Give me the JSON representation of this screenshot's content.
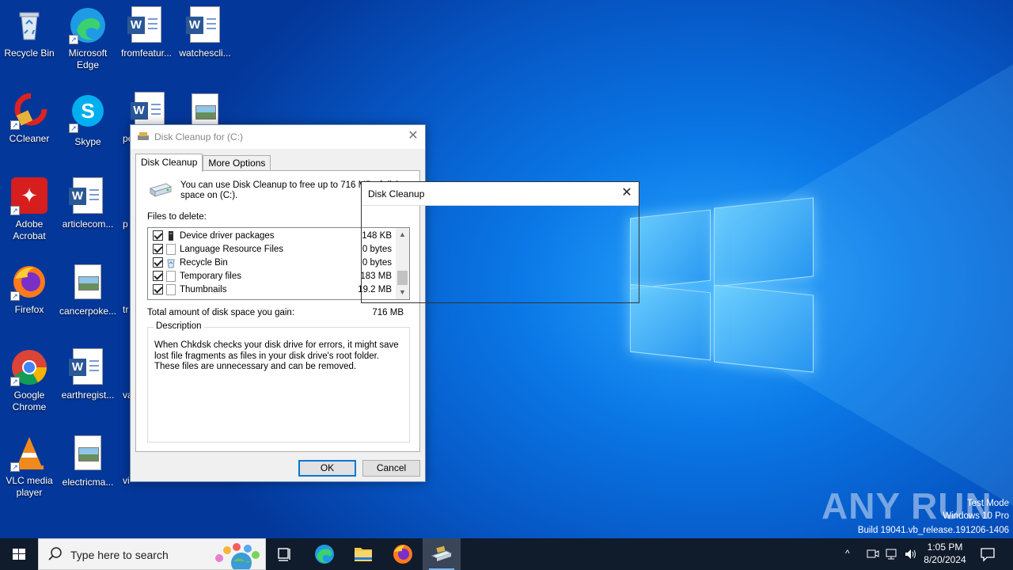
{
  "desktop": {
    "icons": [
      {
        "label": "Recycle Bin",
        "icon": "recycle-bin-icon"
      },
      {
        "label": "Microsoft Edge",
        "icon": "edge-icon"
      },
      {
        "label": "fromfeatur...",
        "icon": "word-document-icon"
      },
      {
        "label": "watchescli...",
        "icon": "word-document-icon"
      },
      {
        "label": "CCleaner",
        "icon": "ccleaner-icon"
      },
      {
        "label": "Skype",
        "icon": "skype-icon"
      },
      {
        "label": "pe",
        "icon": "word-document-icon"
      },
      {
        "label": "Adobe Acrobat",
        "icon": "acrobat-icon"
      },
      {
        "label": "articlecom...",
        "icon": "word-document-icon"
      },
      {
        "label": "p",
        "icon": "word-document-icon"
      },
      {
        "label": "Firefox",
        "icon": "firefox-icon"
      },
      {
        "label": "cancerpoke...",
        "icon": "image-file-icon"
      },
      {
        "label": "tr",
        "icon": "file-icon"
      },
      {
        "label": "Google Chrome",
        "icon": "chrome-icon"
      },
      {
        "label": "earthregist...",
        "icon": "word-document-icon"
      },
      {
        "label": "va",
        "icon": "file-icon"
      },
      {
        "label": "VLC media player",
        "icon": "vlc-icon"
      },
      {
        "label": "electricma...",
        "icon": "image-file-icon"
      },
      {
        "label": "vi",
        "icon": "file-icon"
      }
    ]
  },
  "disk_cleanup": {
    "title": "Disk Cleanup for  (C:)",
    "tabs": [
      "Disk Cleanup",
      "More Options"
    ],
    "intro": "You can use Disk Cleanup to free up to 716 MB of disk space on  (C:).",
    "files_to_delete_label": "Files to delete:",
    "files": [
      {
        "name": "Device driver packages",
        "size": "148 KB",
        "checked": true
      },
      {
        "name": "Language Resource Files",
        "size": "0 bytes",
        "checked": true
      },
      {
        "name": "Recycle Bin",
        "size": "0 bytes",
        "checked": true
      },
      {
        "name": "Temporary files",
        "size": "183 MB",
        "checked": true
      },
      {
        "name": "Thumbnails",
        "size": "19.2 MB",
        "checked": true
      }
    ],
    "total_label": "Total amount of disk space you gain:",
    "total_value": "716 MB",
    "description_legend": "Description",
    "description": "When Chkdsk checks your disk drive for errors, it might save lost file fragments as files in your disk drive's root folder. These files are unnecessary and can be removed.",
    "ok_label": "OK",
    "cancel_label": "Cancel"
  },
  "popup": {
    "title": "Disk Cleanup"
  },
  "taskbar": {
    "search_placeholder": "Type here to search",
    "time": "1:05 PM",
    "date": "8/20/2024"
  },
  "watermark": {
    "brand": "ANY RUN",
    "line1": "Test Mode",
    "line2": "Windows 10 Pro",
    "line3": "Build 19041.vb_release.191206-1406"
  }
}
